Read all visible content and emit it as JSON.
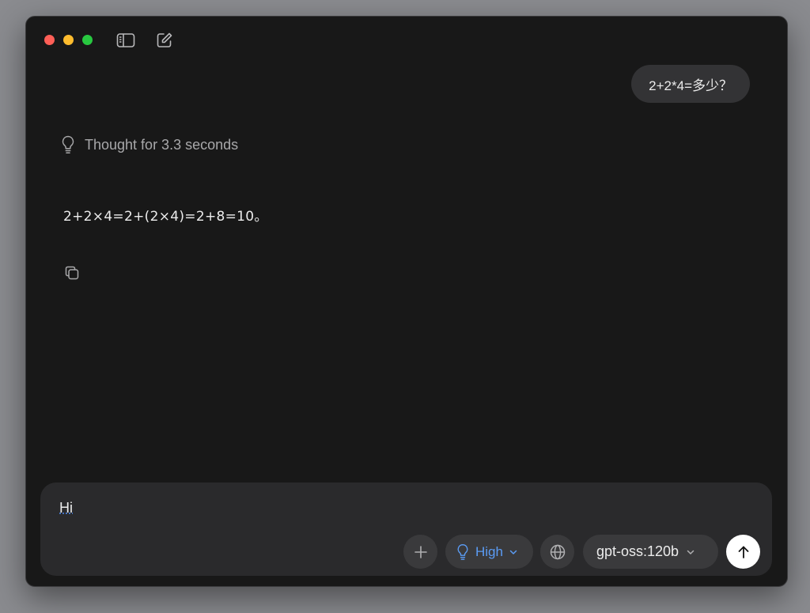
{
  "window": {
    "traffic_lights": [
      "close",
      "minimize",
      "zoom"
    ],
    "toolbar": {
      "sidebar_icon": "sidebar-icon",
      "compose_icon": "compose-icon"
    }
  },
  "conversation": {
    "user_message": "2+2*4=多少？",
    "thought": {
      "icon": "lightbulb-icon",
      "label": "Thought for 3.3 seconds"
    },
    "assistant_message": "2+2×4=2+(2×4)=2+8=10。",
    "copy_icon": "copy-icon"
  },
  "composer": {
    "input_value": "Hi",
    "add_icon": "plus-icon",
    "reasoning": {
      "icon": "lightbulb-icon",
      "label": "High"
    },
    "web_icon": "globe-icon",
    "model": {
      "label": "gpt-oss:120b"
    },
    "send_icon": "arrow-up-icon"
  },
  "colors": {
    "window_bg": "#181818",
    "bubble_bg": "#333335",
    "composer_bg": "#2a2a2c",
    "accent_blue": "#5b9cf5",
    "text": "#ececec",
    "muted_text": "#a8a8aa"
  }
}
